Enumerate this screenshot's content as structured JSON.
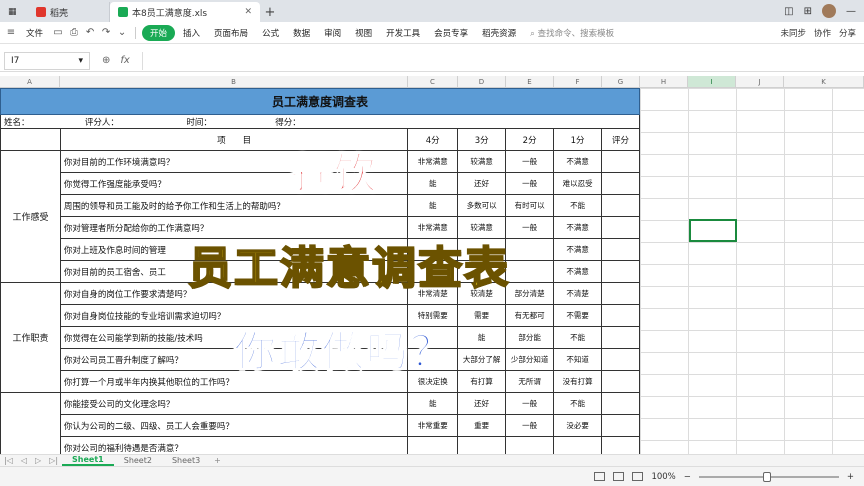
{
  "titlebar": {
    "tabs": [
      {
        "label": "稻壳",
        "color": "#e0362c"
      },
      {
        "label": "本8员工满意度.xls",
        "color": "#1aaa55"
      }
    ]
  },
  "menubar": {
    "file_label": "文件",
    "items": [
      "开始",
      "插入",
      "页面布局",
      "公式",
      "数据",
      "审阅",
      "视图",
      "开发工具",
      "会员专享",
      "稻壳资源"
    ],
    "active_item": "开始",
    "search_placeholder": "查找命令、搜索模板",
    "right_items": [
      "未同步",
      "协作",
      "分享"
    ]
  },
  "formulabar": {
    "cell_ref": "I7",
    "fx": "fx"
  },
  "columns": [
    "A",
    "B",
    "C",
    "D",
    "E",
    "F",
    "G",
    "H",
    "I",
    "J",
    "K"
  ],
  "survey": {
    "title": "员工满意度调查表",
    "info": [
      "姓名：",
      "评分人：",
      "时间：",
      "得分："
    ],
    "header": {
      "item": "项　　目",
      "s4": "4分",
      "s3": "3分",
      "s2": "2分",
      "s1": "1分",
      "score": "评分"
    },
    "categories": [
      "工作感受",
      "工作职责"
    ],
    "rows": [
      {
        "q": "你对目前的工作环境满意吗？",
        "a": [
          "非常满意",
          "较满意",
          "一般",
          "不满意"
        ]
      },
      {
        "q": "你觉得工作强度能承受吗？",
        "a": [
          "能",
          "还好",
          "一般",
          "难以忍受"
        ]
      },
      {
        "q": "周围的领导和员工能及时的给予你工作和生活上的帮助吗？",
        "a": [
          "能",
          "多数可以",
          "有时可以",
          "不能"
        ]
      },
      {
        "q": "你对管理者所分配给你的工作满意吗？",
        "a": [
          "非常满意",
          "较满意",
          "一般",
          "不满意"
        ]
      },
      {
        "q": "你对上班及作息时间的管理",
        "a": [
          "",
          "",
          "",
          "不满意"
        ]
      },
      {
        "q": "你对目前的员工宿舍、员工",
        "a": [
          "",
          "",
          "",
          "不满意"
        ]
      },
      {
        "q": "你对自身的岗位工作要求清楚吗？",
        "a": [
          "非常清楚",
          "较清楚",
          "部分清楚",
          "不清楚"
        ]
      },
      {
        "q": "你对自身岗位技能的专业培训需求迫切吗？",
        "a": [
          "特别需要",
          "需要",
          "有无都可",
          "不需要"
        ]
      },
      {
        "q": "你觉得在公司能学到新的技能/技术吗",
        "a": [
          "",
          "能",
          "部分能",
          "不能"
        ]
      },
      {
        "q": "你对公司员工晋升制度了解吗？",
        "a": [
          "",
          "大部分了解",
          "少部分知道",
          "不知道"
        ]
      },
      {
        "q": "你打算一个月或半年内换其他职位的工作吗？",
        "a": [
          "很决定换",
          "有打算",
          "无所谓",
          "没有打算"
        ]
      },
      {
        "q": "你能接受公司的文化理念吗？",
        "a": [
          "能",
          "还好",
          "一般",
          "不能"
        ]
      },
      {
        "q": "你认为公司的二级、四级、员工人会重要吗？",
        "a": [
          "非常重要",
          "重要",
          "一般",
          "没必要"
        ]
      },
      {
        "q": "你对公司的福利待遇是否满意？",
        "a": [
          "",
          "",
          "",
          ""
        ]
      }
    ]
  },
  "overlay": {
    "line1": "餐饮",
    "line2": "员工满意调查表",
    "line3": "你敢做吗？"
  },
  "sheets": [
    "Sheet1",
    "Sheet2",
    "Sheet3"
  ],
  "status": {
    "zoom": "100%"
  }
}
